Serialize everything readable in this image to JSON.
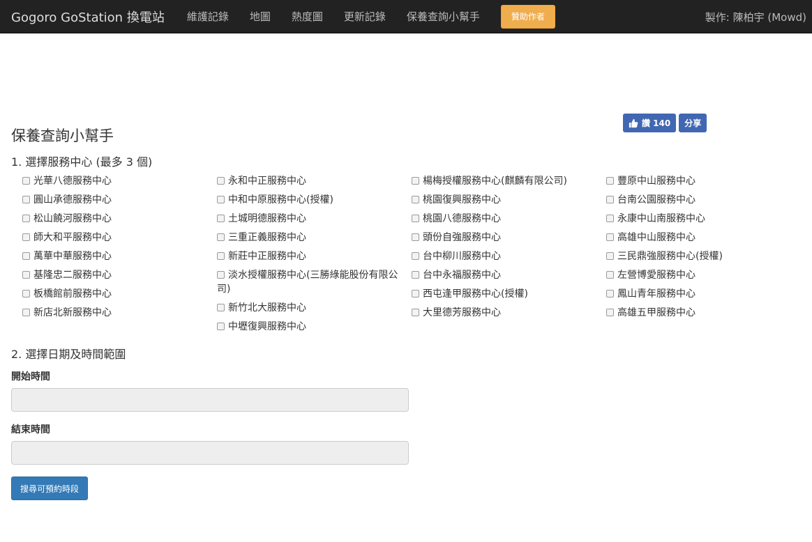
{
  "navbar": {
    "brand": "Gogoro GoStation 換電站",
    "links": [
      "維護記錄",
      "地圖",
      "熱度圖",
      "更新記錄",
      "保養查詢小幫手"
    ],
    "sponsor_label": "贊助作者",
    "author": "製作: 陳柏宇 (Mowd)"
  },
  "facebook": {
    "like_label": "讚 140",
    "share_label": "分享"
  },
  "page": {
    "title": "保養查詢小幫手",
    "step1_title": "1. 選擇服務中心 (最多 3 個)",
    "step2_title": "2. 選擇日期及時間範圍",
    "start_label": "開始時間",
    "start_value": "",
    "end_label": "結束時間",
    "end_value": "",
    "search_label": "搜尋可預約時段"
  },
  "centers": [
    [
      "光華八德服務中心",
      "圓山承德服務中心",
      "松山饒河服務中心",
      "師大和平服務中心",
      "萬華中華服務中心",
      "基隆忠二服務中心",
      "板橋館前服務中心",
      "新店北新服務中心"
    ],
    [
      "永和中正服務中心",
      "中和中原服務中心(授權)",
      "土城明德服務中心",
      "三重正義服務中心",
      "新莊中正服務中心",
      "淡水授權服務中心(三勝綠能股份有限公司)",
      "新竹北大服務中心",
      "中壢復興服務中心"
    ],
    [
      "楊梅授權服務中心(麒麟有限公司)",
      "桃園復興服務中心",
      "桃園八德服務中心",
      "頭份自強服務中心",
      "台中柳川服務中心",
      "台中永福服務中心",
      "西屯逢甲服務中心(授權)",
      "大里德芳服務中心"
    ],
    [
      "豐原中山服務中心",
      "台南公園服務中心",
      "永康中山南服務中心",
      "高雄中山服務中心",
      "三民鼎強服務中心(授權)",
      "左營博愛服務中心",
      "鳳山青年服務中心",
      "高雄五甲服務中心"
    ]
  ]
}
